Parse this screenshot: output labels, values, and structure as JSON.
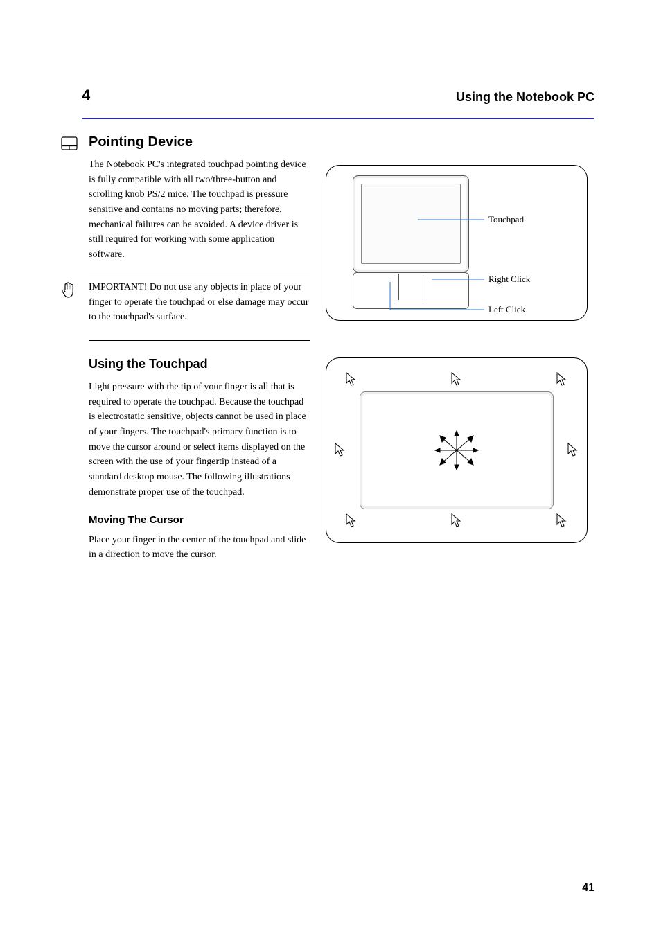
{
  "header": {
    "chapter_number": "4",
    "chapter_title": "Using the Notebook PC"
  },
  "section": {
    "title": "Pointing Device",
    "paragraph1": "The Notebook PC's integrated touchpad pointing device is fully compatible with all two/three-button and scrolling knob PS/2 mice. The touchpad is pressure sensitive and contains no moving parts; therefore, mechanical failures can be avoided. A device driver is still required for working with some application software.",
    "note": "IMPORTANT! Do not use any objects in place of your finger to operate the touchpad or else damage may occur to the touchpad's surface.",
    "subheading": "Using the Touchpad",
    "paragraph2": "Light pressure with the tip of your finger is all that is required to operate the touchpad. Because the touchpad is electrostatic sensitive, objects cannot be used in place of your fingers. The touchpad's primary function is to move the cursor around or select items displayed on the screen with the use of your fingertip instead of a standard desktop mouse. The following illustrations demonstrate proper use of the touchpad.",
    "sub2": "Moving The Cursor",
    "paragraph3": "Place your finger in the center of the touchpad and slide in a direction to move the cursor."
  },
  "figure1": {
    "callout_pad": "Touchpad",
    "callout_right": "Right Click",
    "callout_left": "Left Click"
  },
  "figure2": {
    "arrows_desc": "Eight-direction cursor movement"
  },
  "page_number": "41"
}
